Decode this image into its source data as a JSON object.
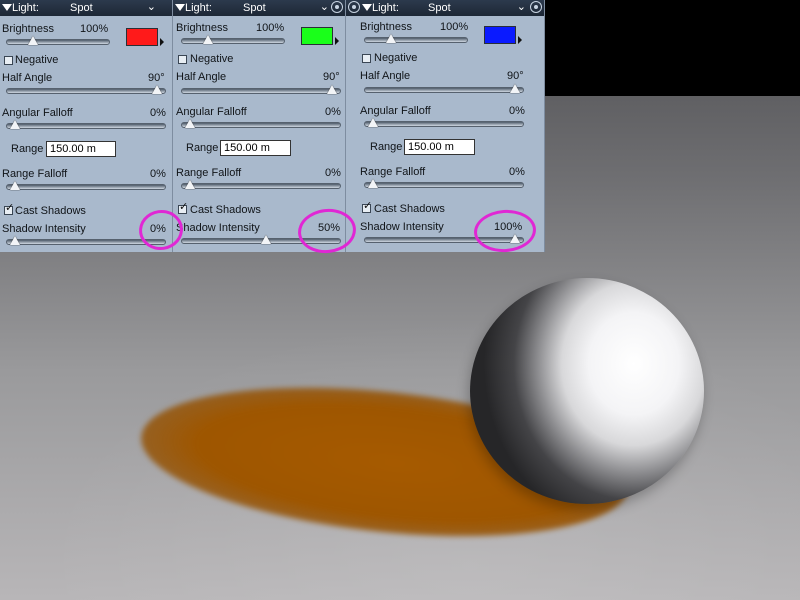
{
  "panels": [
    {
      "title": "Light:",
      "type": "Spot",
      "brightness": {
        "label": "Brightness",
        "value": "100%",
        "fraction": 0.15
      },
      "color": "#ff1a1a",
      "negative": {
        "label": "Negative",
        "checked": false
      },
      "half_angle": {
        "label": "Half Angle",
        "value": "90°",
        "fraction": 0.98
      },
      "angular_falloff": {
        "label": "Angular Falloff",
        "value": "0%",
        "fraction": 0.02
      },
      "range": {
        "label": "Range",
        "value": "150.00 m"
      },
      "range_falloff": {
        "label": "Range Falloff",
        "value": "0%",
        "fraction": 0.02
      },
      "cast_shadows": {
        "label": "Cast Shadows",
        "checked": true
      },
      "shadow_intensity": {
        "label": "Shadow Intensity",
        "value": "0%",
        "fraction": 0.02
      }
    },
    {
      "title": "Light:",
      "type": "Spot",
      "brightness": {
        "label": "Brightness",
        "value": "100%",
        "fraction": 0.15
      },
      "color": "#1aff1a",
      "negative": {
        "label": "Negative",
        "checked": false
      },
      "half_angle": {
        "label": "Half Angle",
        "value": "90°",
        "fraction": 0.98
      },
      "angular_falloff": {
        "label": "Angular Falloff",
        "value": "0%",
        "fraction": 0.02
      },
      "range": {
        "label": "Range",
        "value": "150.00 m"
      },
      "range_falloff": {
        "label": "Range Falloff",
        "value": "0%",
        "fraction": 0.02
      },
      "cast_shadows": {
        "label": "Cast Shadows",
        "checked": true
      },
      "shadow_intensity": {
        "label": "Shadow Intensity",
        "value": "50%",
        "fraction": 0.5
      }
    },
    {
      "title": "Light:",
      "type": "Spot",
      "brightness": {
        "label": "Brightness",
        "value": "100%",
        "fraction": 0.15
      },
      "color": "#0a1aff",
      "negative": {
        "label": "Negative",
        "checked": false
      },
      "half_angle": {
        "label": "Half Angle",
        "value": "90°",
        "fraction": 0.98
      },
      "angular_falloff": {
        "label": "Angular Falloff",
        "value": "0%",
        "fraction": 0.02
      },
      "range": {
        "label": "Range",
        "value": "150.00 m"
      },
      "range_falloff": {
        "label": "Range Falloff",
        "value": "0%",
        "fraction": 0.02
      },
      "cast_shadows": {
        "label": "Cast Shadows",
        "checked": true
      },
      "shadow_intensity": {
        "label": "Shadow Intensity",
        "value": "100%",
        "fraction": 0.98
      }
    }
  ],
  "annotation_color": "#e027d4",
  "render": {
    "shadow_color": "#a65a00"
  }
}
